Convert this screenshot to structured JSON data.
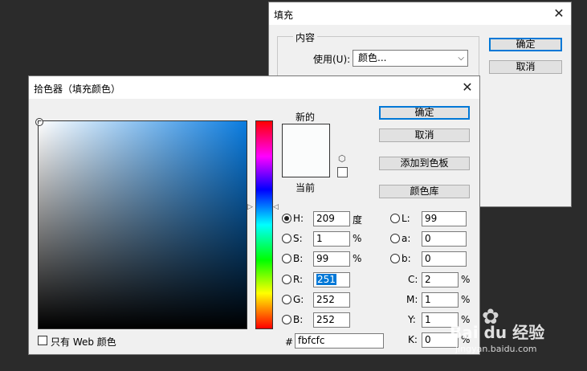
{
  "fill_dialog": {
    "title": "填充",
    "content_legend": "内容",
    "use_label": "使用(U):",
    "use_value": "颜色...",
    "ok_label": "确定",
    "cancel_label": "取消"
  },
  "picker": {
    "title": "拾色器（填充颜色）",
    "new_label": "新的",
    "current_label": "当前",
    "new_color": "#fbfcfc",
    "current_color": "#fbfcfc",
    "buttons": {
      "ok": "确定",
      "cancel": "取消",
      "add_swatch": "添加到色板",
      "color_libraries": "颜色库"
    },
    "fields": {
      "H": {
        "label": "H:",
        "value": "209",
        "unit": "度"
      },
      "S": {
        "label": "S:",
        "value": "1",
        "unit": "%"
      },
      "B": {
        "label": "B:",
        "value": "99",
        "unit": "%"
      },
      "R": {
        "label": "R:",
        "value": "251"
      },
      "G": {
        "label": "G:",
        "value": "252"
      },
      "Bl": {
        "label": "B:",
        "value": "252"
      },
      "L": {
        "label": "L:",
        "value": "99"
      },
      "a": {
        "label": "a:",
        "value": "0"
      },
      "b": {
        "label": "b:",
        "value": "0"
      },
      "C": {
        "label": "C:",
        "value": "2",
        "unit": "%"
      },
      "M": {
        "label": "M:",
        "value": "1",
        "unit": "%"
      },
      "Y": {
        "label": "Y:",
        "value": "1",
        "unit": "%"
      },
      "K": {
        "label": "K:",
        "value": "0",
        "unit": "%"
      }
    },
    "hash_label": "#",
    "hex_value": "fbfcfc",
    "web_only_label": "只有 Web 颜色",
    "hue_color": "#0a7ce0"
  },
  "watermark": {
    "brand": "Bai du 经验",
    "url": "jingyan.baidu.com"
  }
}
